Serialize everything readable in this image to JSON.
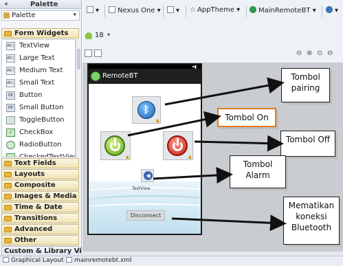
{
  "palette": {
    "title": "Palette",
    "combo_label": "Palette",
    "form_widgets_label": "Form Widgets",
    "widgets": [
      {
        "label": "TextView",
        "icon": "Ab|",
        "kind": "text"
      },
      {
        "label": "Large Text",
        "icon": "Ab|",
        "kind": "text"
      },
      {
        "label": "Medium Text",
        "icon": "Ab|",
        "kind": "text"
      },
      {
        "label": "Small Text",
        "icon": "Ab|",
        "kind": "text"
      },
      {
        "label": "Button",
        "icon": "OK",
        "kind": "btn"
      },
      {
        "label": "Small Button",
        "icon": "OK",
        "kind": "btn"
      },
      {
        "label": "ToggleButton",
        "icon": "",
        "kind": "tog"
      },
      {
        "label": "CheckBox",
        "icon": "✓",
        "kind": "chk"
      },
      {
        "label": "RadioButton",
        "icon": "",
        "kind": "rad"
      },
      {
        "label": "CheckedTextView",
        "icon": "",
        "kind": "chk"
      }
    ],
    "categories": [
      "Text Fields",
      "Layouts",
      "Composite",
      "Images & Media",
      "Time & Date",
      "Transitions",
      "Advanced",
      "Other",
      "Custom & Library Views"
    ]
  },
  "toolbar": {
    "device": "Nexus One",
    "theme": "AppTheme",
    "activity": "MainRemoteBT",
    "api_level": "18"
  },
  "phone": {
    "app_title": "RemoteBT",
    "textview_label": "TextView",
    "disconnect_label": "Disconnect"
  },
  "annotations": {
    "pairing": "Tombol pairing",
    "on": "Tombol On",
    "off": "Tombol Off",
    "alarm": "Tombol Alarm",
    "disconnect": "Mematikan koneksi Bluetooth"
  },
  "bottom_tabs": {
    "graphical_layout": "Graphical Layout",
    "xml_file": "mainremotebt.xml"
  },
  "colors": {
    "accent_orange": "#e07a1f",
    "android_green": "#8cc63f",
    "category_gold": "#e8b43a"
  }
}
